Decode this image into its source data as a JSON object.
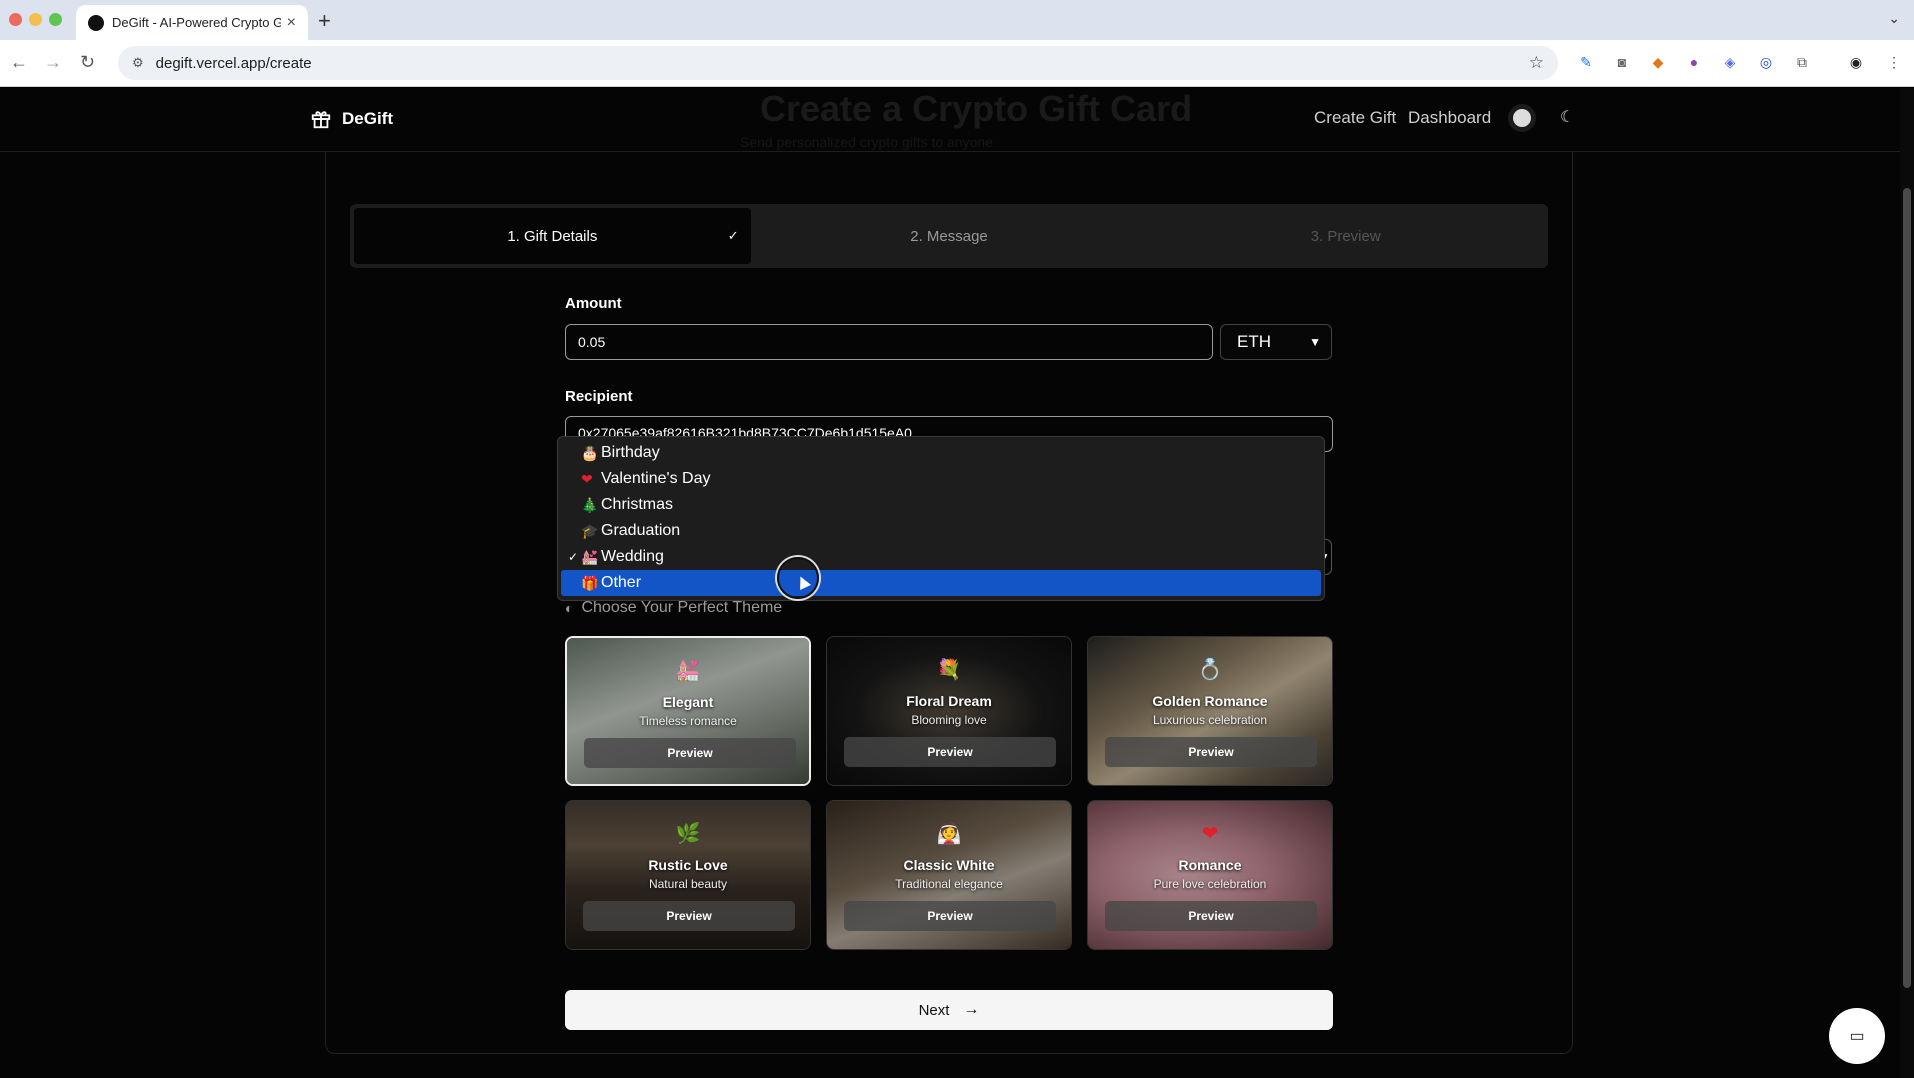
{
  "browser": {
    "tab_title": "DeGift - AI-Powered Crypto G",
    "tab_close": "×",
    "new_tab": "+",
    "url": "degift.vercel.app/create"
  },
  "header": {
    "brand": "DeGift",
    "nav": [
      "Create Gift",
      "Dashboard"
    ],
    "ghost_title": "Create a Crypto Gift Card",
    "ghost_subtitle": "Send personalized crypto gifts to anyone"
  },
  "steps": [
    {
      "label": "1. Gift Details",
      "state": "active"
    },
    {
      "label": "2. Message",
      "state": "pending"
    },
    {
      "label": "3. Preview",
      "state": "disabled"
    }
  ],
  "form": {
    "amount_label": "Amount",
    "amount_value": "0.05",
    "currency": "ETH",
    "recipient_label": "Recipient",
    "recipient_value": "0x27065e39af82616B321bd8B73CC7De6b1d515eA0"
  },
  "occasion_dropdown": {
    "options": [
      {
        "label": "Birthday",
        "emoji": "🎂"
      },
      {
        "label": "Valentine's Day",
        "emoji": "❤"
      },
      {
        "label": "Christmas",
        "emoji": "🎄"
      },
      {
        "label": "Graduation",
        "emoji": "🎓"
      },
      {
        "label": "Wedding",
        "emoji": "💒"
      },
      {
        "label": "Other",
        "emoji": "🎁"
      }
    ],
    "checked": "Wedding",
    "highlighted": "Other"
  },
  "themes": {
    "heading": "Choose Your Perfect Theme",
    "preview_label": "Preview",
    "items": [
      {
        "name": "Elegant",
        "desc": "Timeless romance",
        "emoji": "💒",
        "selected": true
      },
      {
        "name": "Floral Dream",
        "desc": "Blooming love",
        "emoji": "💐",
        "selected": false
      },
      {
        "name": "Golden Romance",
        "desc": "Luxurious celebration",
        "emoji": "💍",
        "selected": false
      },
      {
        "name": "Rustic Love",
        "desc": "Natural beauty",
        "emoji": "🌿",
        "selected": false
      },
      {
        "name": "Classic White",
        "desc": "Traditional elegance",
        "emoji": "👰",
        "selected": false
      },
      {
        "name": "Romance",
        "desc": "Pure love celebration",
        "emoji": "❤",
        "selected": false
      }
    ]
  },
  "next_label": "Next",
  "colors": {
    "accent": "#1354c6",
    "background": "#050505"
  }
}
